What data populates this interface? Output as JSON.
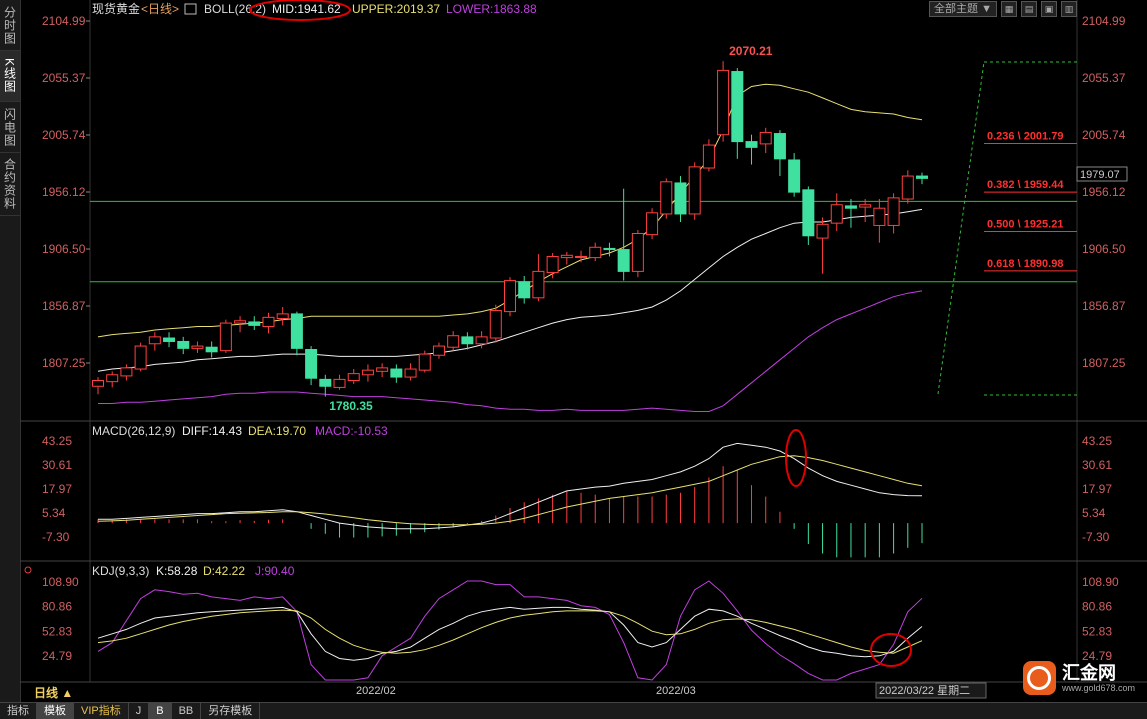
{
  "sidebar": {
    "tabs": [
      {
        "label": "分时图"
      },
      {
        "label": "K线图",
        "active": true
      },
      {
        "label": "闪电图"
      },
      {
        "label": "合约资料"
      }
    ]
  },
  "header": {
    "instrument": "现货黄金",
    "period": "<日线>",
    "boll_name": "BOLL(26,2)",
    "boll_mid": "MID:1941.62",
    "boll_upper": "UPPER:2019.37",
    "boll_lower": "LOWER:1863.88",
    "theme_button": "全部主题",
    "theme_arrow": "▼"
  },
  "main_axis": {
    "ticks": [
      "2104.99",
      "2055.37",
      "2005.74",
      "1956.12",
      "1906.50",
      "1856.87",
      "1807.25"
    ],
    "current_price": "1979.07"
  },
  "price_labels": {
    "high": "2070.21",
    "low": "1780.35"
  },
  "fibonacci": [
    {
      "label": "0.236 \\ 2001.79",
      "price": 2001.79
    },
    {
      "label": "0.382 \\ 1959.44",
      "price": 1959.44
    },
    {
      "label": "0.500 \\ 1925.21",
      "price": 1925.21
    },
    {
      "label": "0.618 \\ 1890.98",
      "price": 1890.98
    }
  ],
  "macd": {
    "name": "MACD(26,12,9)",
    "diff": "DIFF:14.43",
    "dea": "DEA:19.70",
    "macd": "MACD:-10.53",
    "ticks": [
      "43.25",
      "30.61",
      "17.97",
      "5.34",
      "-7.30"
    ]
  },
  "kdj": {
    "name": "KDJ(9,3,3)",
    "k": "K:58.28",
    "d": "D:42.22",
    "j": "J:90.40",
    "ticks": [
      "108.90",
      "80.86",
      "52.83",
      "24.79"
    ]
  },
  "xaxis": {
    "labels": [
      "2022/02",
      "2022/03"
    ],
    "cursor_date": "2022/03/22 星期二"
  },
  "bottom_tabs": [
    "指标",
    "模板",
    "VIP指标",
    "J",
    "B",
    "BB",
    "另存模板"
  ],
  "period_button": "日线 ▲",
  "logo": {
    "name": "汇金网",
    "url": "www.gold678.com"
  },
  "colors": {
    "up": "#ff4040",
    "down": "#40e0a0",
    "mid": "#f0f0f0",
    "upper": "#e8e070",
    "lower": "#c040e0",
    "fib": "#ff3030",
    "support": "#30c030"
  },
  "chart_data": {
    "type": "candlestick",
    "candles": [
      [
        1787,
        1792,
        1780,
        1795
      ],
      [
        1791,
        1797,
        1786,
        1800
      ],
      [
        1796,
        1803,
        1792,
        1806
      ],
      [
        1802,
        1822,
        1800,
        1825
      ],
      [
        1824,
        1830,
        1818,
        1834
      ],
      [
        1829,
        1826,
        1821,
        1834
      ],
      [
        1826,
        1820,
        1815,
        1830
      ],
      [
        1820,
        1822,
        1816,
        1826
      ],
      [
        1821,
        1817,
        1812,
        1826
      ],
      [
        1818,
        1842,
        1816,
        1845
      ],
      [
        1842,
        1844,
        1834,
        1848
      ],
      [
        1843,
        1840,
        1836,
        1848
      ],
      [
        1839,
        1847,
        1833,
        1851
      ],
      [
        1846,
        1850,
        1840,
        1856
      ],
      [
        1850,
        1820,
        1814,
        1852
      ],
      [
        1819,
        1794,
        1788,
        1822
      ],
      [
        1793,
        1787,
        1778,
        1797
      ],
      [
        1786,
        1793,
        1784,
        1797
      ],
      [
        1792,
        1798,
        1789,
        1802
      ],
      [
        1797,
        1801,
        1791,
        1806
      ],
      [
        1800,
        1803,
        1795,
        1807
      ],
      [
        1802,
        1795,
        1790,
        1806
      ],
      [
        1795,
        1802,
        1792,
        1807
      ],
      [
        1801,
        1815,
        1799,
        1818
      ],
      [
        1814,
        1822,
        1811,
        1825
      ],
      [
        1821,
        1831,
        1818,
        1835
      ],
      [
        1830,
        1824,
        1819,
        1834
      ],
      [
        1824,
        1830,
        1820,
        1835
      ],
      [
        1829,
        1853,
        1825,
        1858
      ],
      [
        1852,
        1879,
        1848,
        1882
      ],
      [
        1878,
        1864,
        1859,
        1883
      ],
      [
        1864,
        1887,
        1861,
        1902
      ],
      [
        1886,
        1900,
        1881,
        1903
      ],
      [
        1899,
        1901,
        1893,
        1904
      ],
      [
        1900,
        1900,
        1895,
        1905
      ],
      [
        1899,
        1908,
        1896,
        1912
      ],
      [
        1907,
        1906,
        1900,
        1912
      ],
      [
        1906,
        1887,
        1879,
        1959
      ],
      [
        1887,
        1920,
        1882,
        1923
      ],
      [
        1919,
        1938,
        1915,
        1942
      ],
      [
        1937,
        1965,
        1933,
        1968
      ],
      [
        1964,
        1937,
        1930,
        1970
      ],
      [
        1937,
        1978,
        1932,
        1982
      ],
      [
        1977,
        1997,
        1974,
        2002
      ],
      [
        2006,
        2062,
        2000,
        2070
      ],
      [
        2061,
        2000,
        1985,
        2064
      ],
      [
        2000,
        1995,
        1980,
        2006
      ],
      [
        1998,
        2008,
        1990,
        2012
      ],
      [
        2007,
        1985,
        1970,
        2010
      ],
      [
        1984,
        1956,
        1952,
        1990
      ],
      [
        1958,
        1918,
        1910,
        1961
      ],
      [
        1916,
        1928,
        1885,
        1934
      ],
      [
        1929,
        1945,
        1922,
        1955
      ],
      [
        1944,
        1942,
        1925,
        1950
      ],
      [
        1943,
        1945,
        1930,
        1950
      ],
      [
        1927,
        1942,
        1912,
        1950
      ],
      [
        1927,
        1951,
        1920,
        1955
      ],
      [
        1950,
        1970,
        1946,
        1975
      ],
      [
        1970,
        1968,
        1963,
        1973
      ]
    ],
    "upper": [
      1830,
      1832,
      1833,
      1834,
      1836,
      1837,
      1838,
      1839,
      1839,
      1840,
      1841,
      1842,
      1843,
      1845,
      1846,
      1848,
      1848,
      1848,
      1848,
      1848,
      1848,
      1848,
      1848,
      1848,
      1848,
      1849,
      1850,
      1852,
      1855,
      1862,
      1870,
      1878,
      1885,
      1891,
      1897,
      1900,
      1903,
      1908,
      1915,
      1925,
      1940,
      1955,
      1970,
      1985,
      2010,
      2040,
      2048,
      2050,
      2049,
      2046,
      2043,
      2038,
      2033,
      2028,
      2026,
      2025,
      2024,
      2021,
      2019
    ],
    "mid": [
      1800,
      1802,
      1803,
      1804,
      1806,
      1807,
      1808,
      1810,
      1811,
      1812,
      1813,
      1813,
      1814,
      1815,
      1815,
      1815,
      1814,
      1813,
      1813,
      1813,
      1813,
      1813,
      1814,
      1815,
      1816,
      1818,
      1820,
      1823,
      1826,
      1830,
      1834,
      1838,
      1842,
      1845,
      1847,
      1848,
      1849,
      1851,
      1853,
      1856,
      1862,
      1870,
      1880,
      1890,
      1900,
      1908,
      1915,
      1920,
      1925,
      1929,
      1930,
      1930,
      1932,
      1934,
      1935,
      1936,
      1937,
      1939,
      1941
    ],
    "lower": [
      1772,
      1772,
      1773,
      1773,
      1774,
      1775,
      1776,
      1777,
      1778,
      1780,
      1781,
      1781,
      1782,
      1782,
      1782,
      1781,
      1780,
      1779,
      1778,
      1778,
      1778,
      1777,
      1776,
      1775,
      1774,
      1773,
      1771,
      1770,
      1768,
      1767,
      1767,
      1766,
      1766,
      1767,
      1766,
      1766,
      1766,
      1766,
      1767,
      1768,
      1767,
      1766,
      1765,
      1765,
      1770,
      1780,
      1790,
      1800,
      1810,
      1820,
      1830,
      1838,
      1845,
      1850,
      1855,
      1860,
      1865,
      1868,
      1870
    ],
    "macd_diff": [
      2,
      2,
      2.5,
      3,
      3.5,
      4,
      4.5,
      5,
      5,
      5.5,
      6,
      6,
      6.5,
      7,
      6,
      4,
      2,
      0,
      -1,
      -2,
      -2.5,
      -3,
      -3,
      -3,
      -2.5,
      -2,
      -1,
      0,
      2,
      5,
      8,
      11,
      14,
      17,
      18,
      19,
      19.5,
      21,
      22,
      23,
      25,
      27,
      30,
      34,
      40,
      42,
      41,
      40,
      38,
      34,
      29,
      25,
      22,
      20,
      18,
      16,
      15,
      14.5,
      14.43
    ],
    "macd_dea": [
      1,
      1.2,
      1.5,
      2,
      2.5,
      3,
      3.5,
      4,
      4.5,
      5,
      5.2,
      5.4,
      5.6,
      6,
      6,
      5.5,
      4.8,
      3.8,
      2.8,
      1.8,
      1,
      0.3,
      -0.3,
      -0.6,
      -0.8,
      -0.9,
      -0.8,
      -0.6,
      0,
      1,
      2.5,
      4.5,
      6.5,
      8.5,
      10,
      11.5,
      13,
      14,
      15,
      16,
      17.5,
      19,
      20.5,
      22,
      25,
      28,
      31,
      33,
      35,
      35.5,
      34.5,
      33,
      31,
      29,
      27,
      25,
      23,
      21,
      19.7
    ],
    "kdj_k": [
      45,
      50,
      55,
      62,
      68,
      70,
      72,
      74,
      75,
      76,
      77,
      78,
      79,
      80,
      75,
      50,
      30,
      22,
      20,
      22,
      28,
      30,
      35,
      45,
      55,
      62,
      70,
      75,
      78,
      80,
      78,
      79,
      80,
      80,
      78,
      77,
      75,
      60,
      40,
      35,
      40,
      55,
      70,
      78,
      76,
      70,
      62,
      55,
      48,
      42,
      35,
      30,
      28,
      25,
      24,
      25,
      30,
      45,
      58.28
    ],
    "kdj_d": [
      40,
      42,
      45,
      50,
      55,
      60,
      64,
      67,
      70,
      72,
      74,
      75,
      76,
      77,
      76,
      68,
      55,
      45,
      37,
      32,
      29,
      28,
      29,
      32,
      37,
      43,
      50,
      57,
      63,
      68,
      71,
      73,
      75,
      76,
      76,
      76,
      75,
      70,
      62,
      53,
      49,
      50,
      55,
      62,
      66,
      67,
      66,
      63,
      59,
      55,
      50,
      45,
      40,
      35,
      31,
      29,
      28,
      35,
      42.22
    ],
    "kdj_j": [
      30,
      40,
      65,
      90,
      100,
      98,
      95,
      96,
      92,
      90,
      88,
      92,
      90,
      92,
      75,
      15,
      -10,
      -5,
      -10,
      0,
      25,
      35,
      45,
      70,
      90,
      100,
      110,
      110,
      106,
      106,
      92,
      92,
      90,
      88,
      82,
      80,
      72,
      40,
      0,
      -5,
      15,
      70,
      100,
      110,
      96,
      76,
      54,
      39,
      26,
      16,
      5,
      -5,
      -5,
      5,
      10,
      15,
      38,
      75,
      90.4
    ],
    "fib_high": 2070.21,
    "fib_low": 1780.35,
    "support_levels": [
      1948,
      1878
    ]
  }
}
